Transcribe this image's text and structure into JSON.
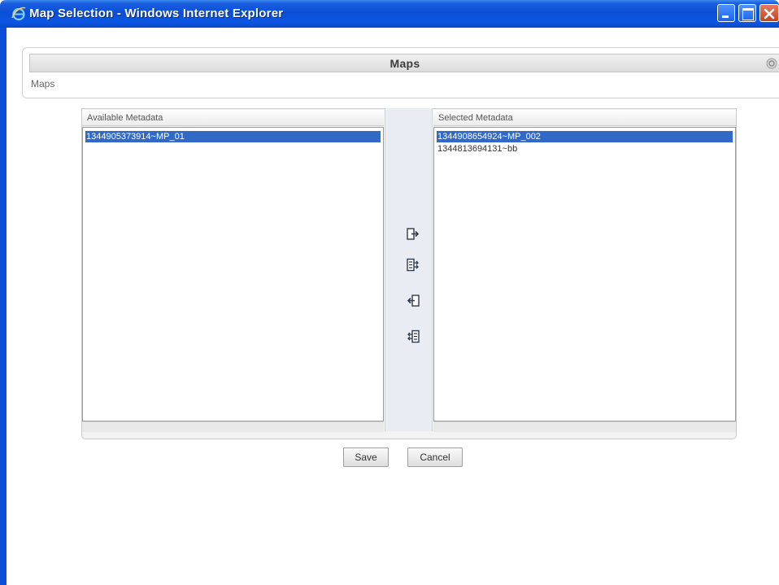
{
  "window": {
    "title": "Map Selection - Windows Internet Explorer",
    "titlebar_color": "#0a4fd6"
  },
  "header": {
    "title": "Maps",
    "breadcrumb": "Maps",
    "help_icon": "help-icon"
  },
  "shuttle": {
    "available": {
      "label": "Available Metadata",
      "items": [
        {
          "text": "1344905373914~MP_01",
          "selected": true
        }
      ]
    },
    "selected": {
      "label": "Selected Metadata",
      "items": [
        {
          "text": "1344908654924~MP_002",
          "selected": true
        },
        {
          "text": "1344813694131~bb",
          "selected": false
        }
      ]
    },
    "controls": [
      "move-right-icon",
      "move-all-right-icon",
      "move-left-icon",
      "move-all-left-icon"
    ],
    "selection_color": "#3169c6"
  },
  "actions": {
    "save": "Save",
    "cancel": "Cancel"
  }
}
